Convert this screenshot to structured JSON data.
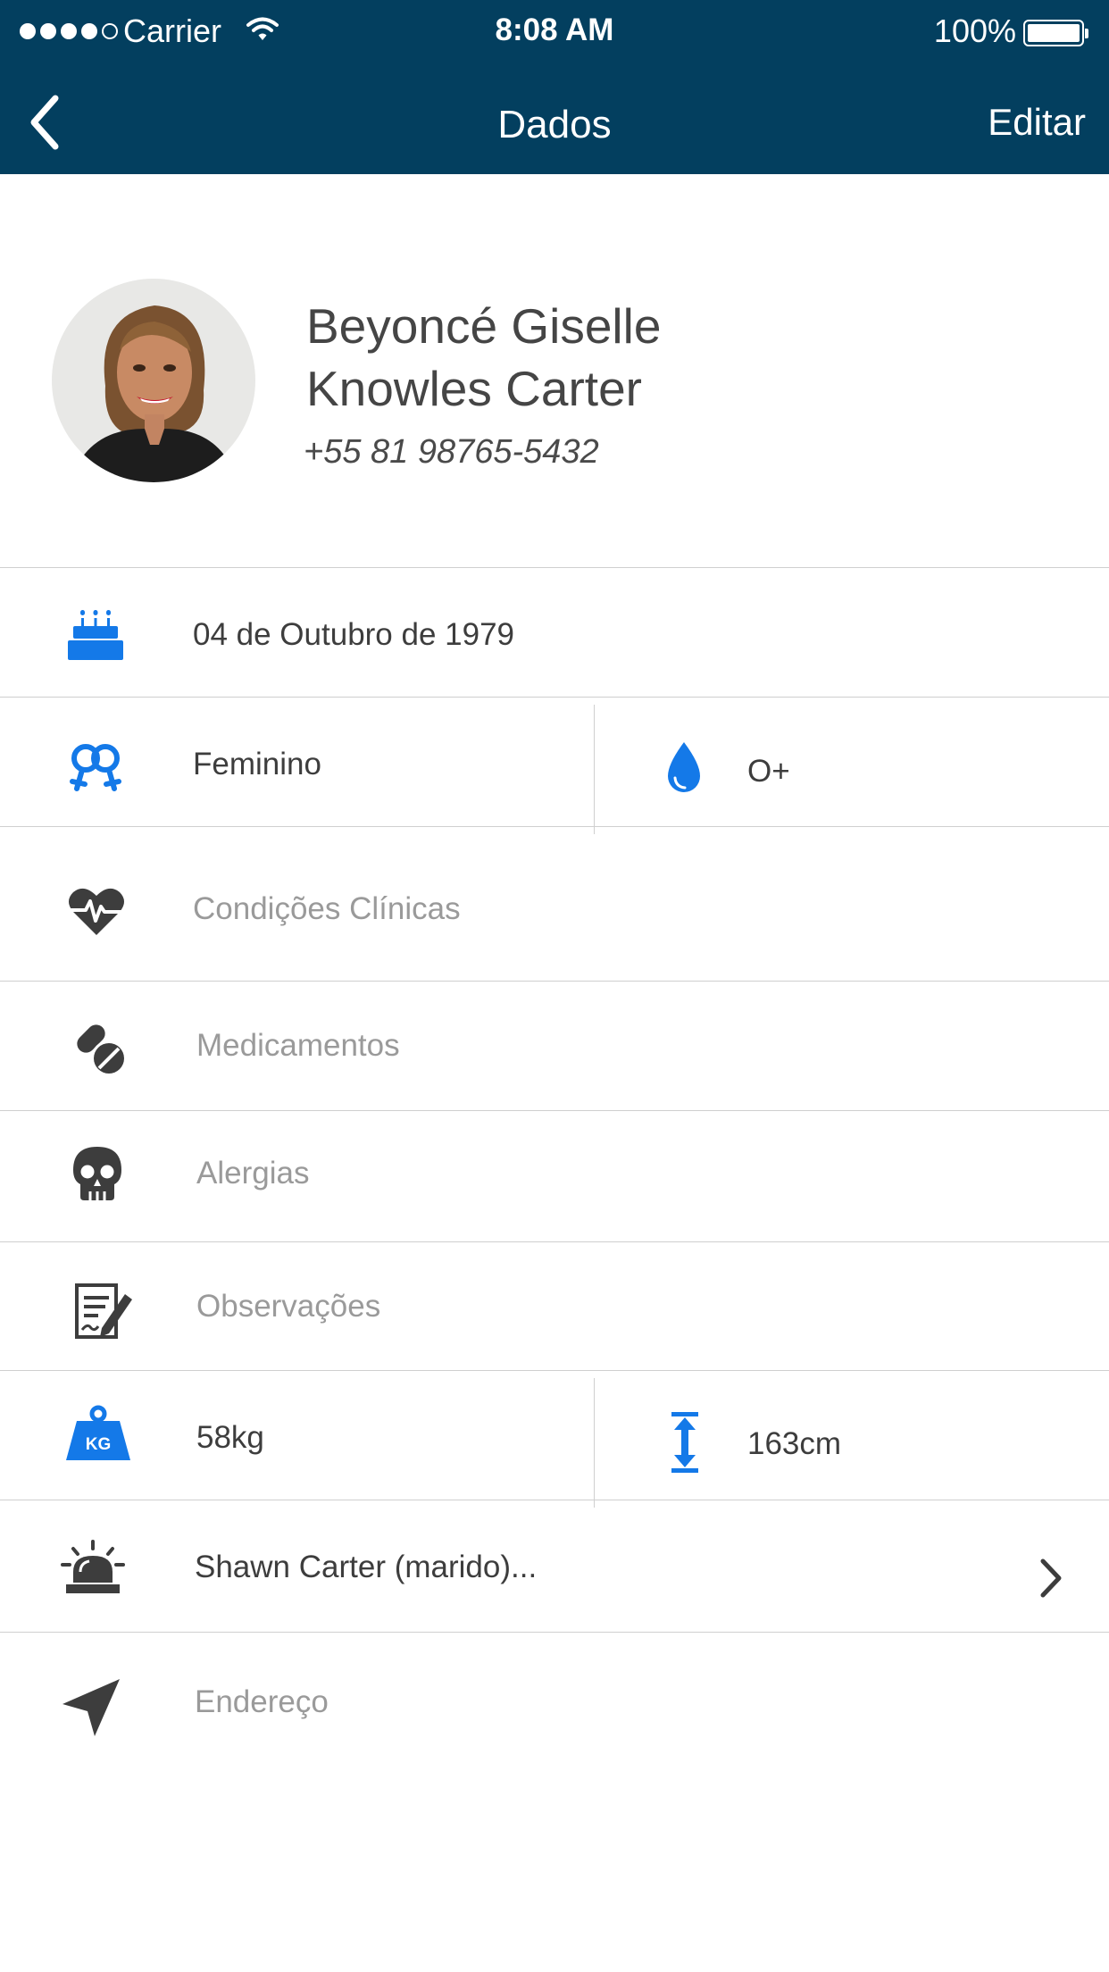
{
  "status_bar": {
    "carrier": "Carrier",
    "time": "8:08 AM",
    "battery": "100%"
  },
  "nav": {
    "title": "Dados",
    "edit_label": "Editar",
    "back_icon": "chevron-left-icon"
  },
  "profile": {
    "name_line1": "Beyoncé Giselle",
    "name_line2": "Knowles Carter",
    "phone": "+55 81 98765-5432"
  },
  "rows": {
    "birthday": {
      "value": "04 de Outubro de 1979",
      "icon": "birthday-cake-icon"
    },
    "gender": {
      "value": "Feminino",
      "icon": "gender-female-icon"
    },
    "blood_type": {
      "value": "O+",
      "icon": "blood-drop-icon"
    },
    "conditions": {
      "placeholder": "Condições Clínicas",
      "icon": "heart-pulse-icon"
    },
    "medications": {
      "placeholder": "Medicamentos",
      "icon": "pills-icon"
    },
    "allergies": {
      "placeholder": "Alergias",
      "icon": "skull-icon"
    },
    "notes": {
      "placeholder": "Observações",
      "icon": "notes-icon"
    },
    "weight": {
      "value": "58kg",
      "icon": "weight-kg-icon",
      "icon_text": "KG"
    },
    "height": {
      "value": "163cm",
      "icon": "height-arrow-icon"
    },
    "emergency_contact": {
      "value": "Shawn Carter (marido)...",
      "icon": "alarm-siren-icon"
    },
    "address": {
      "placeholder": "Endereço",
      "icon": "location-arrow-icon"
    }
  },
  "colors": {
    "nav_bg": "#033f5f",
    "accent_blue": "#1479e8",
    "icon_dark": "#3d3d3d",
    "placeholder_gray": "#9a9a9a",
    "divider": "#cfcfcf"
  }
}
